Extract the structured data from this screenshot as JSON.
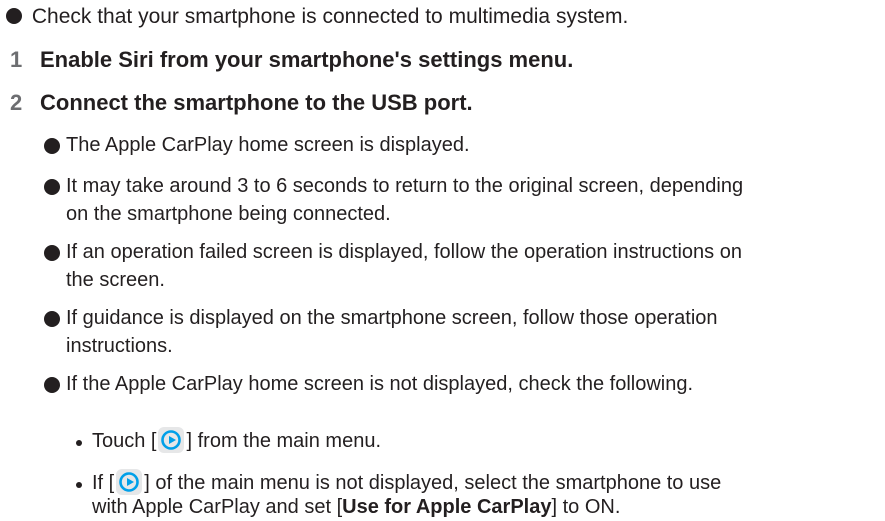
{
  "intro": "Check that your smartphone is connected to multimedia system.",
  "steps": [
    {
      "number": "1",
      "text": "Enable Siri from your smartphone's settings menu."
    },
    {
      "number": "2",
      "text": "Connect the smartphone to the USB port."
    }
  ],
  "notes": [
    {
      "lines": [
        "The Apple CarPlay home screen is displayed."
      ]
    },
    {
      "lines": [
        "It may take around 3 to 6 seconds to return to the original screen, depending",
        "on the smartphone being connected."
      ]
    },
    {
      "lines": [
        "If an operation failed screen is displayed, follow the operation instructions on",
        "the screen."
      ]
    },
    {
      "lines": [
        "If guidance is displayed on the smartphone screen, follow those operation",
        "instructions."
      ]
    },
    {
      "lines": [
        "If the Apple CarPlay home screen is not displayed, check the following."
      ]
    }
  ],
  "checks": {
    "touch_prefix": "Touch [",
    "touch_suffix": "] from the main menu.",
    "if_prefix": "If [",
    "if_suffix": "] of the main menu is not displayed, select the smartphone to use",
    "line2_prefix": "with Apple CarPlay and set [",
    "line2_bold": "Use for Apple CarPlay",
    "line2_suffix": "] to ON."
  },
  "icon": "carplay-icon",
  "colors": {
    "text": "#231f20",
    "step_number": "#6d6e71",
    "icon_bg": "#e6e7e8",
    "icon_fg": "#00a0e9"
  }
}
